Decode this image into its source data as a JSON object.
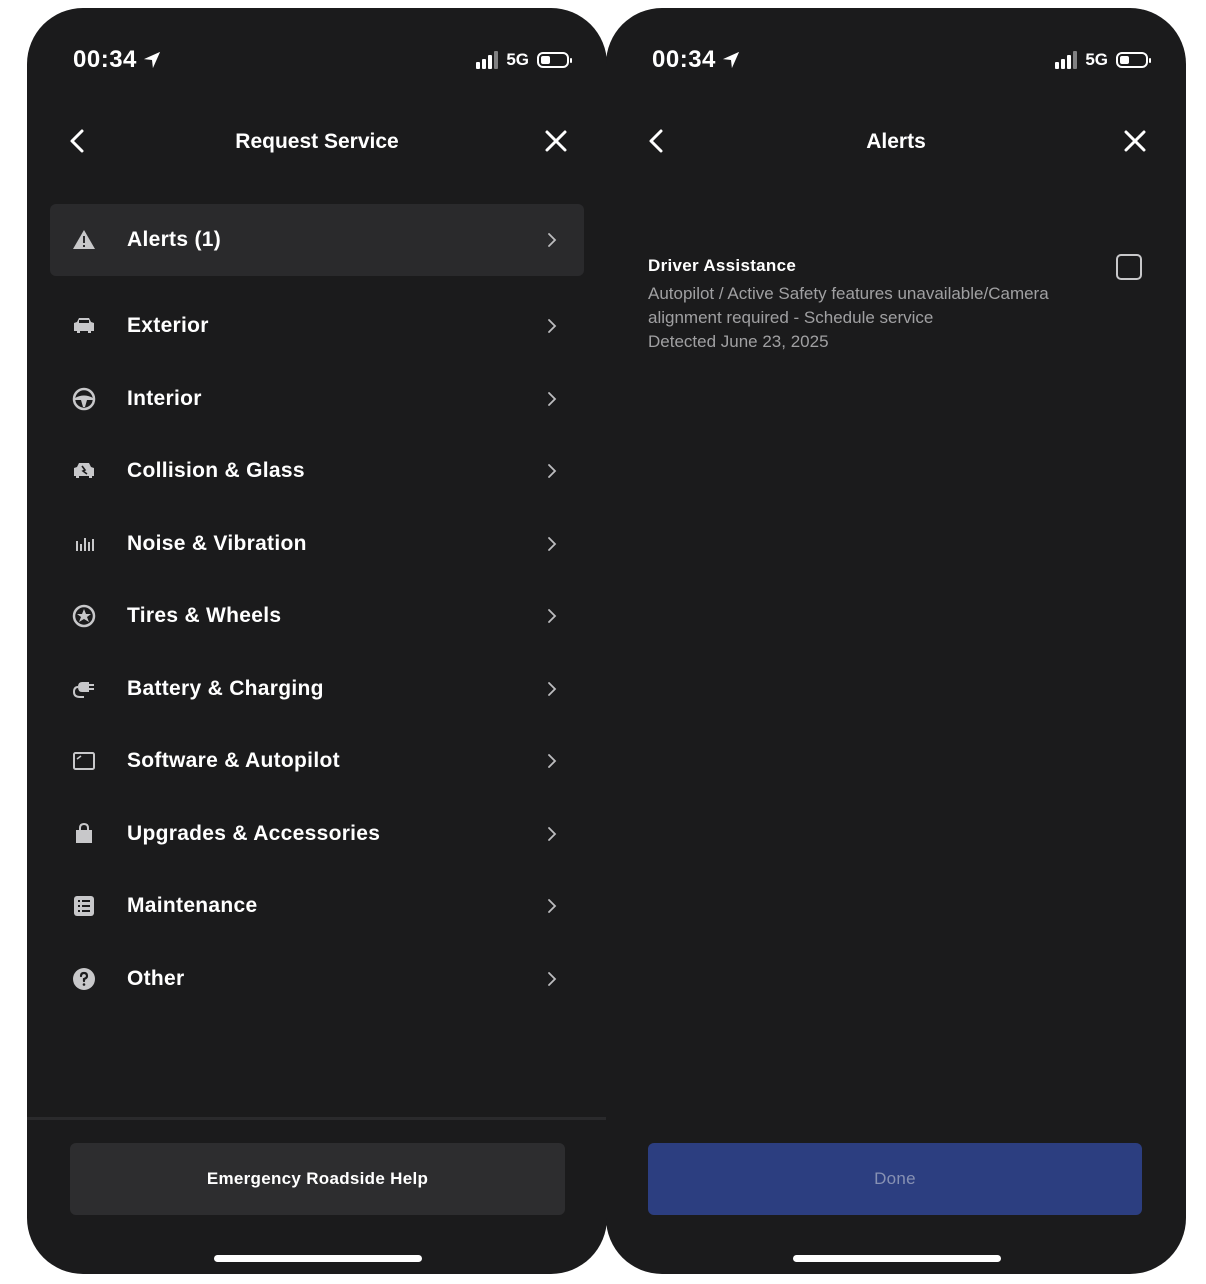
{
  "colors": {
    "background": "#1b1b1c",
    "active_row": "#2a2a2c",
    "secondary_text": "#a0a0a2",
    "done_button": "#2c3e80",
    "done_text": "#8791b3"
  },
  "left_screen": {
    "status": {
      "time": "00:34",
      "network": "5G"
    },
    "nav": {
      "title": "Request Service"
    },
    "menu": [
      {
        "label": "Alerts (1)",
        "icon": "warning-icon"
      },
      {
        "label": "Exterior",
        "icon": "car-icon"
      },
      {
        "label": "Interior",
        "icon": "steering-wheel-icon"
      },
      {
        "label": "Collision & Glass",
        "icon": "collision-icon"
      },
      {
        "label": "Noise & Vibration",
        "icon": "sound-bars-icon"
      },
      {
        "label": "Tires & Wheels",
        "icon": "wheel-icon"
      },
      {
        "label": "Battery & Charging",
        "icon": "charging-plug-icon"
      },
      {
        "label": "Software & Autopilot",
        "icon": "screen-icon"
      },
      {
        "label": "Upgrades & Accessories",
        "icon": "shopping-bag-icon"
      },
      {
        "label": "Maintenance",
        "icon": "checklist-icon"
      },
      {
        "label": "Other",
        "icon": "question-icon"
      }
    ],
    "footer_button": "Emergency Roadside Help"
  },
  "right_screen": {
    "status": {
      "time": "00:34",
      "network": "5G"
    },
    "nav": {
      "title": "Alerts"
    },
    "alert": {
      "title": "Driver Assistance",
      "description": "Autopilot / Active Safety features unavailable/Camera alignment required - Schedule service",
      "detected": "Detected June 23, 2025"
    },
    "footer_button": "Done"
  }
}
